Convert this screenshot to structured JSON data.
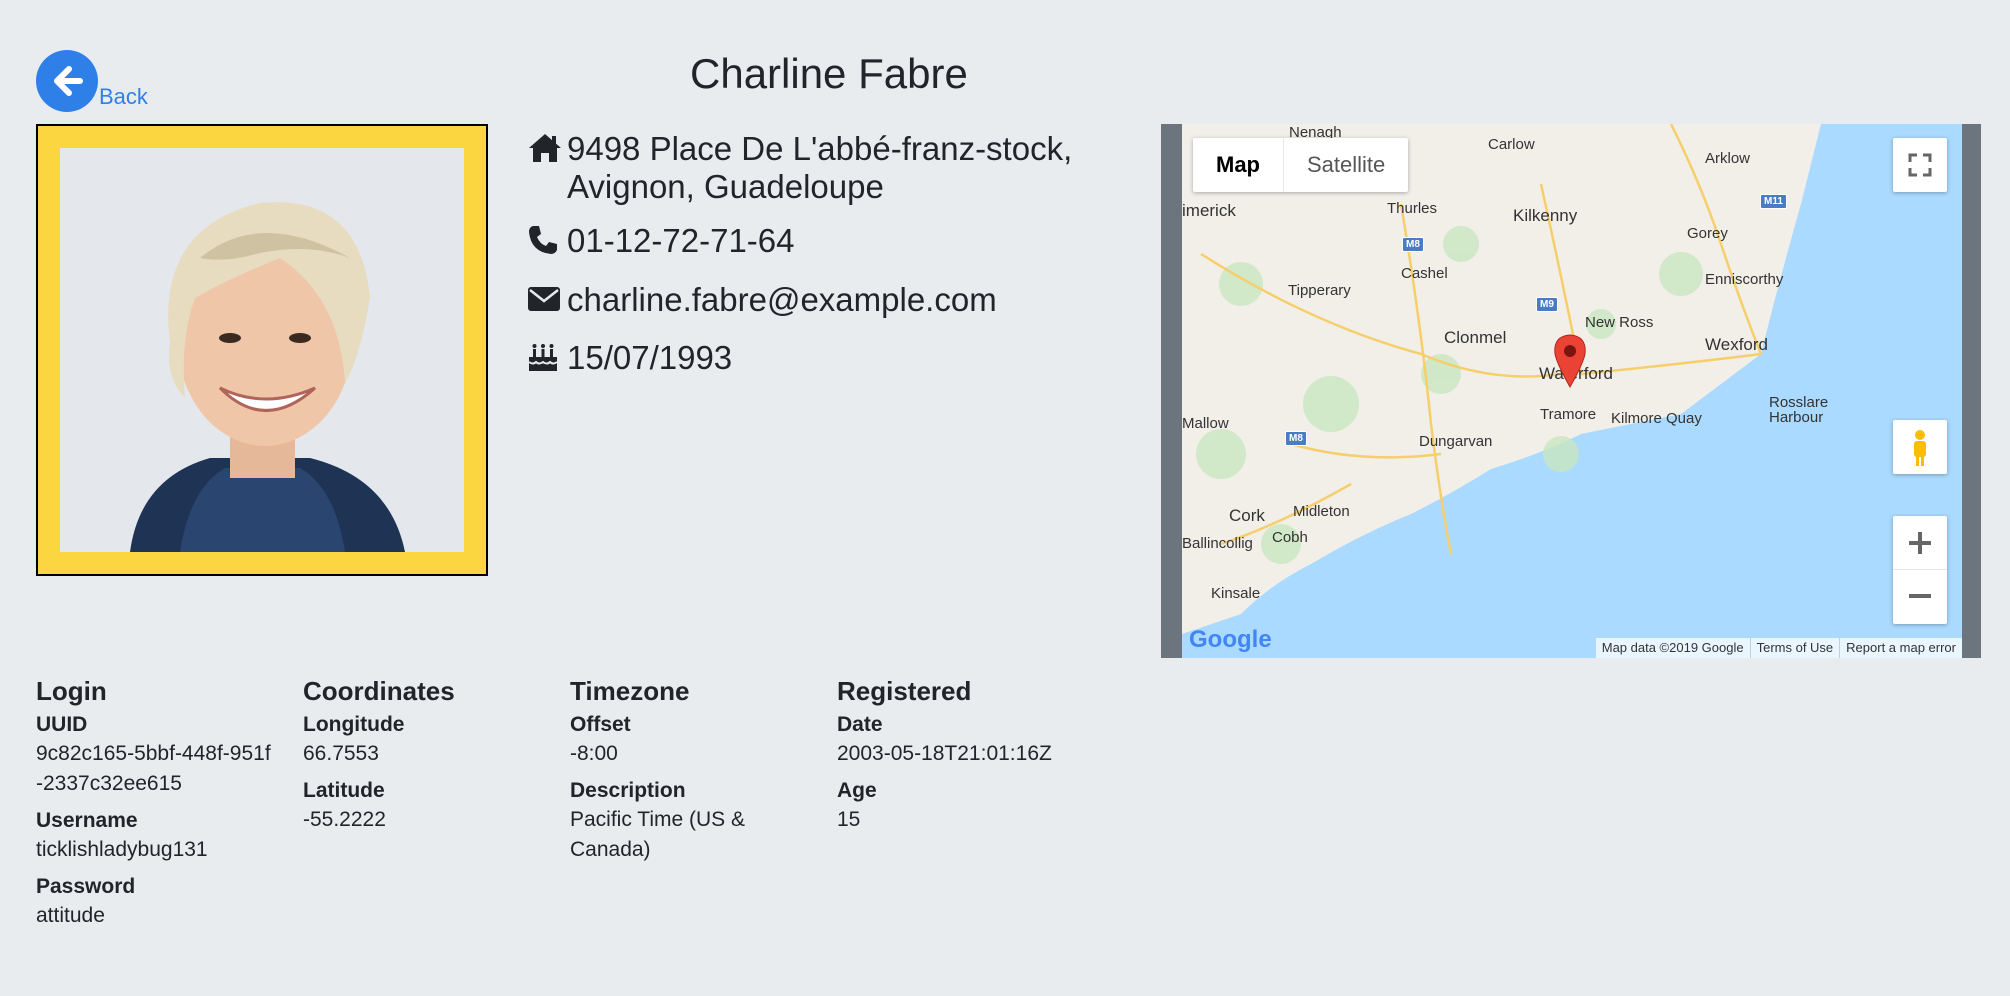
{
  "nav": {
    "back_label": "Back"
  },
  "page": {
    "title": "Charline Fabre"
  },
  "photo": {
    "alt": "Profile photo"
  },
  "contact": {
    "address_line1": "9498 Place De L'abbé-franz-stock,",
    "address_line2": "Avignon, Guadeloupe",
    "phone": "01-12-72-71-64",
    "email": "charline.fabre@example.com",
    "birthday": "15/07/1993"
  },
  "map": {
    "type_map": "Map",
    "type_satellite": "Satellite",
    "footer_data": "Map data ©2019 Google",
    "footer_terms": "Terms of Use",
    "footer_report": "Report a map error",
    "logo": "Google",
    "labels": {
      "nenagh": "Nenagh",
      "carlow": "Carlow",
      "arklow": "Arklow",
      "limerick": "imerick",
      "thurles": "Thurles",
      "kilkenny": "Kilkenny",
      "gorey": "Gorey",
      "cashel": "Cashel",
      "enniscorthy": "Enniscorthy",
      "tipperary": "Tipperary",
      "newross": "New Ross",
      "clonmel": "Clonmel",
      "wexford": "Wexford",
      "waterford": "Waterford",
      "mallow": "Mallow",
      "tramore": "Tramore",
      "kilmore": "Kilmore Quay",
      "rosslare": "Rosslare",
      "harbour": "Harbour",
      "dungarvan": "Dungarvan",
      "cork": "Cork",
      "midleton": "Midleton",
      "ballincollig": "Ballincollig",
      "cobh": "Cobh",
      "kinsale": "Kinsale"
    },
    "roads": {
      "m11": "M11",
      "m8a": "M8",
      "m9": "M9",
      "m8b": "M8"
    }
  },
  "login": {
    "heading": "Login",
    "uuid_label": "UUID",
    "uuid_value": "9c82c165-5bbf-448f-951f-2337c32ee615",
    "username_label": "Username",
    "username_value": "ticklishladybug131",
    "password_label": "Password",
    "password_value": "attitude"
  },
  "coordinates": {
    "heading": "Coordinates",
    "longitude_label": "Longitude",
    "longitude_value": "66.7553",
    "latitude_label": "Latitude",
    "latitude_value": "-55.2222"
  },
  "timezone": {
    "heading": "Timezone",
    "offset_label": "Offset",
    "offset_value": "-8:00",
    "description_label": "Description",
    "description_value": "Pacific Time (US & Canada)"
  },
  "registered": {
    "heading": "Registered",
    "date_label": "Date",
    "date_value": "2003-05-18T21:01:16Z",
    "age_label": "Age",
    "age_value": "15"
  },
  "colors": {
    "accent": "#2f7fe8",
    "frame": "#fbd641",
    "background": "#e9ecef",
    "pin": "#ea4335"
  }
}
